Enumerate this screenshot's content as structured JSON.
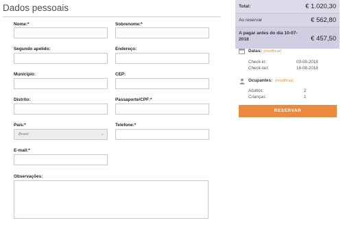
{
  "form": {
    "title": "Dados pessoais",
    "fields": {
      "nome": {
        "label": "Nome:*",
        "value": ""
      },
      "sobrenome": {
        "label": "Sobrenome:*",
        "value": ""
      },
      "segundo_apelido": {
        "label": "Segundo apelido:",
        "value": ""
      },
      "endereco": {
        "label": "Endereço:",
        "value": ""
      },
      "municipio": {
        "label": "Município:",
        "value": ""
      },
      "cep": {
        "label": "CEP:",
        "value": ""
      },
      "distrito": {
        "label": "Distrito:",
        "value": ""
      },
      "passaporte": {
        "label": "Passaporte/CPF:*",
        "value": ""
      },
      "pais": {
        "label": "País:*",
        "value": "Brasil"
      },
      "telefone": {
        "label": "Telefone:*",
        "value": ""
      },
      "email": {
        "label": "E-mail:*",
        "value": ""
      },
      "observacoes": {
        "label": "Observações:",
        "value": ""
      }
    }
  },
  "summary": {
    "total_label": "Total:",
    "total_value": "€ 1.020,30",
    "reserve_label": "Ao reservar",
    "reserve_value": "€ 562,80",
    "pay_label": "A pagar antes do dia 10-07-2018",
    "pay_value": "€ 457,50",
    "dates": {
      "heading": "Datas:",
      "modify": "(modificar)",
      "checkin_label": "Check-in:",
      "checkin_value": "09-08-2018",
      "checkout_label": "Check-out:",
      "checkout_value": "16-08-2018"
    },
    "occupants": {
      "heading": "Ocupantes:",
      "modify": "(modificar)",
      "adults_label": "Adultos:",
      "adults_value": "2",
      "children_label": "Crianças:",
      "children_value": "1"
    },
    "reserve_button": "RESERVAR"
  },
  "icons": {
    "calendar": "calendar-icon",
    "person": "person-icon",
    "chevron": "chevron-down-icon"
  },
  "colors": {
    "accent": "#ea8a3e",
    "summary_bg": "#dcdbe9"
  }
}
